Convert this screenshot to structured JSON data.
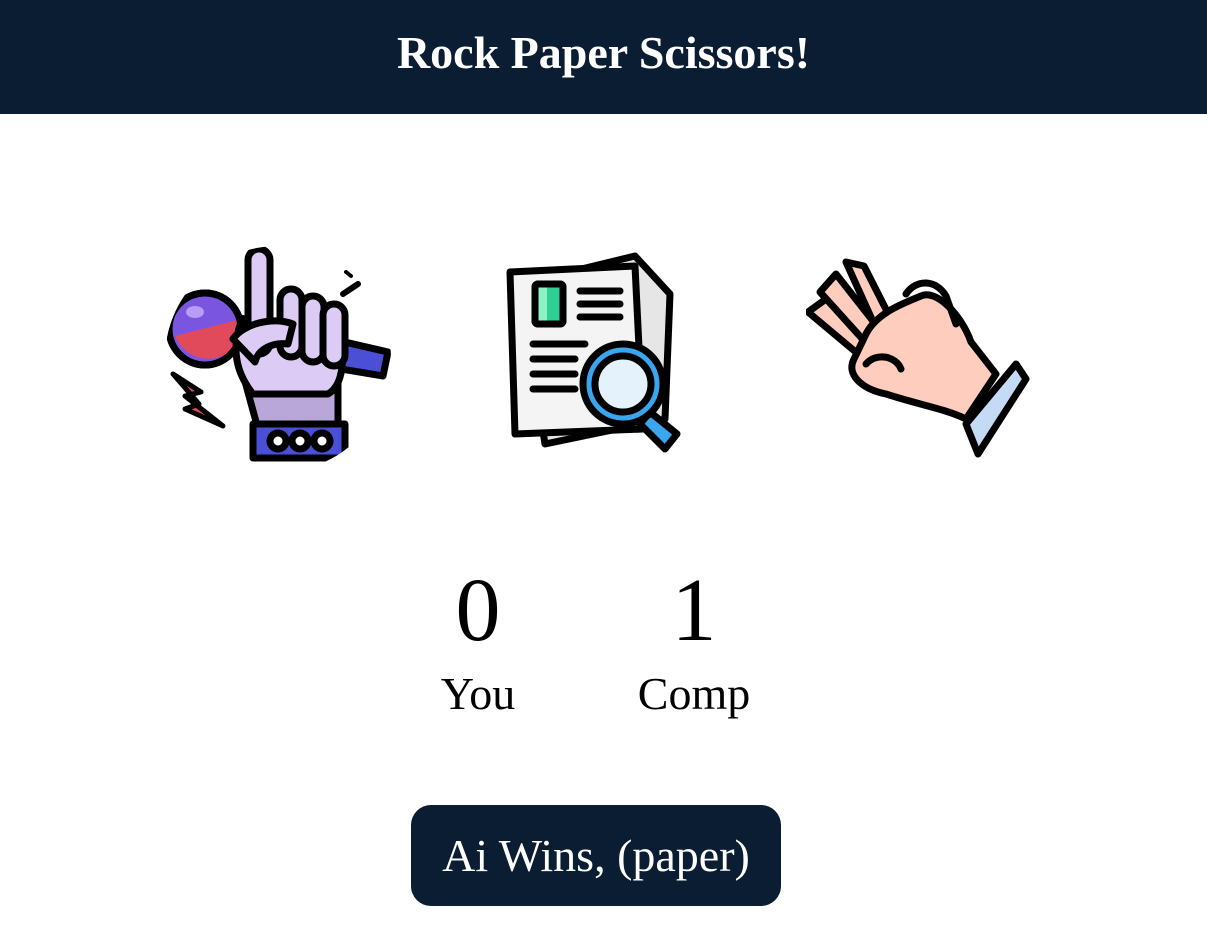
{
  "header": {
    "title": "Rock Paper Scissors!"
  },
  "choices": [
    {
      "id": "rock",
      "icon": "rock-hand-microphone-icon"
    },
    {
      "id": "paper",
      "icon": "paper-document-magnifier-icon"
    },
    {
      "id": "scissors",
      "icon": "scissors-peace-hand-icon"
    }
  ],
  "scoreboard": {
    "user": {
      "score": "0",
      "label": "You"
    },
    "comp": {
      "score": "1",
      "label": "Comp"
    }
  },
  "result": {
    "message": "Ai Wins, (paper)"
  },
  "colors": {
    "navbar": "#0b1d33",
    "text_light": "#ffffff",
    "text_dark": "#000000"
  }
}
